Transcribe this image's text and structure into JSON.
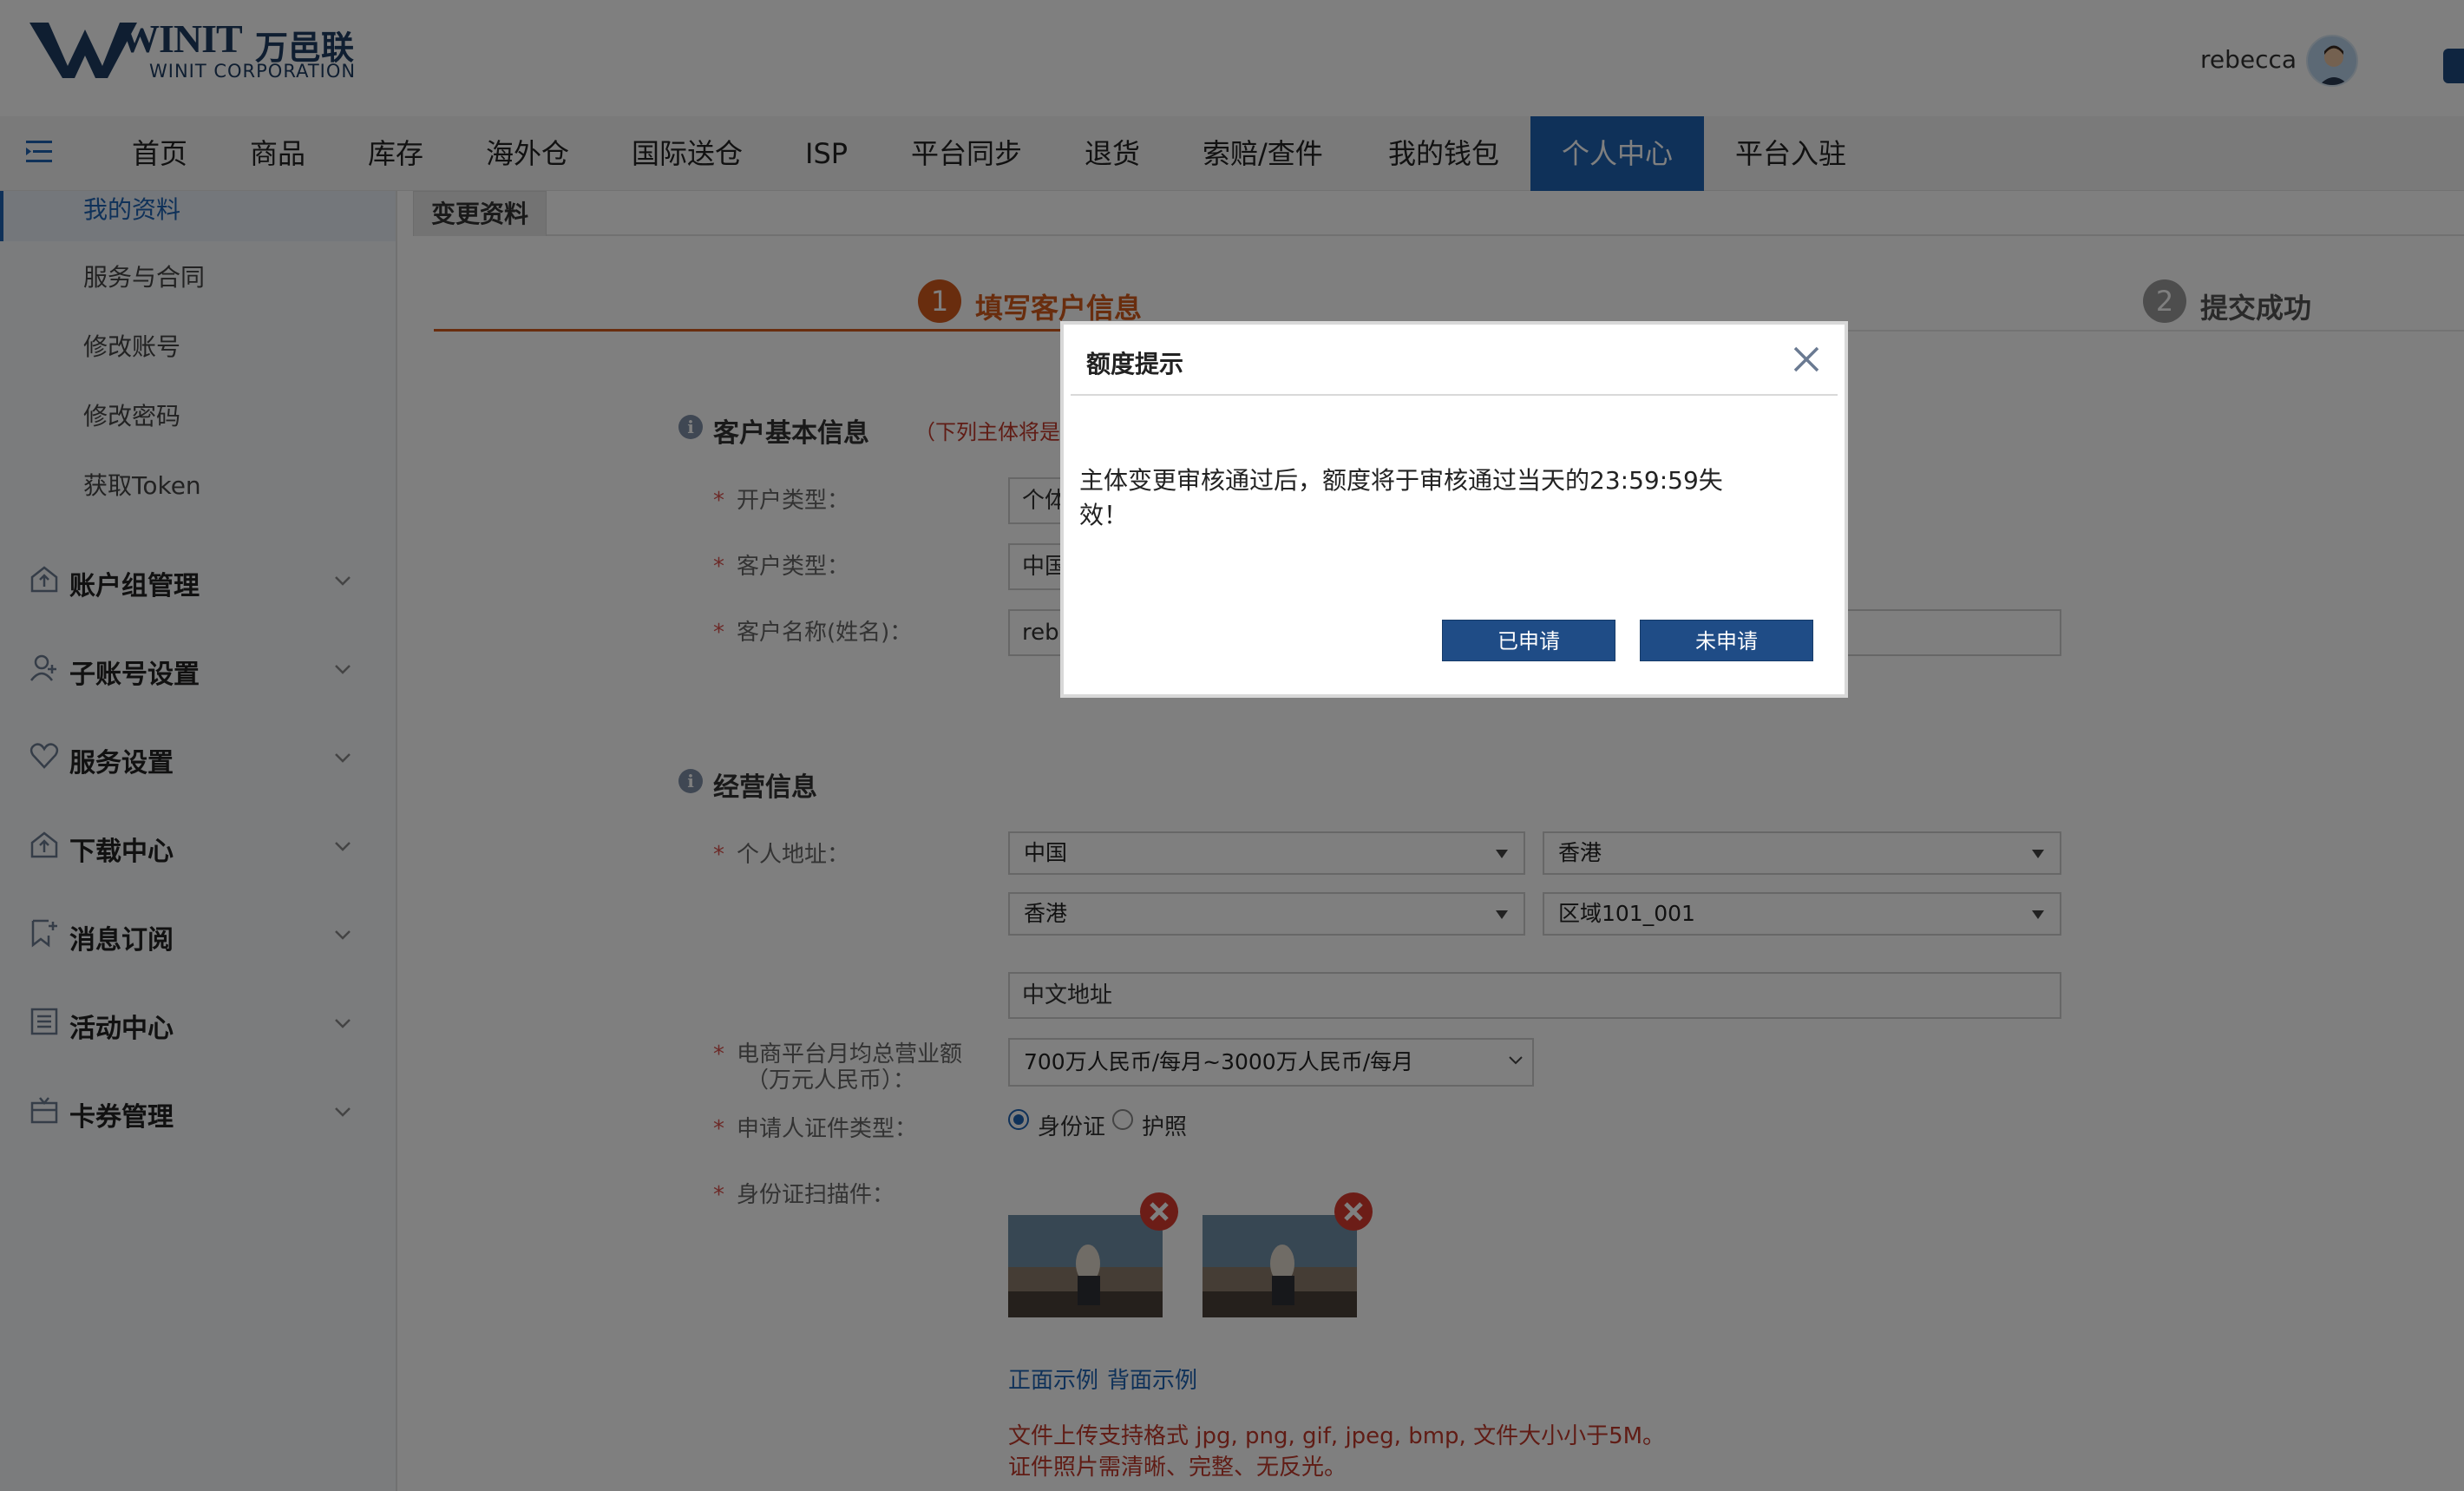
{
  "header": {
    "logo_text": "WINIT",
    "logo_cn": "万邑联",
    "logo_sub": "WINIT CORPORATION",
    "username": "rebecca"
  },
  "nav": {
    "items": [
      "首页",
      "商品",
      "库存",
      "海外仓",
      "国际送仓",
      "ISP",
      "平台同步",
      "退货",
      "索赔/查件",
      "我的钱包",
      "个人中心",
      "平台入驻"
    ],
    "active": "个人中心"
  },
  "sidebar": {
    "sub_items": [
      "我的资料",
      "服务与合同",
      "修改账号",
      "修改密码",
      "获取Token"
    ],
    "groups": [
      "账户组管理",
      "子账号设置",
      "服务设置",
      "下载中心",
      "消息订阅",
      "活动中心",
      "卡券管理"
    ]
  },
  "content": {
    "tab": "变更资料",
    "steps": [
      {
        "num": "1",
        "label": "填写客户信息"
      },
      {
        "num": "2",
        "label": "提交成功"
      }
    ],
    "basic": {
      "title": "客户基本信息",
      "note": "（下列主体将是你",
      "fields": [
        {
          "label": "开户类型：",
          "value": "个体"
        },
        {
          "label": "客户类型：",
          "value": "中国"
        },
        {
          "label": "客户名称(姓名)：",
          "value": "rebe"
        }
      ]
    },
    "business": {
      "title": "经营信息",
      "address_label": "个人地址：",
      "country": "中国",
      "province": "香港",
      "city": "香港",
      "district": "区域101_001",
      "address_cn": "中文地址",
      "revenue_label_1": "电商平台月均总营业额",
      "revenue_label_2": "（万元人民币）：",
      "revenue_value": "700万人民币/每月~3000万人民币/每月",
      "id_type_label": "申请人证件类型：",
      "id_option_1": "身份证",
      "id_option_2": "护照",
      "scan_label": "身份证扫描件：",
      "front_example": "正面示例",
      "back_example": "背面示例",
      "hint_1": "文件上传支持格式 jpg, png, gif, jpeg, bmp, 文件大小小于5M。",
      "hint_2": "证件照片需清晰、完整、无反光。"
    }
  },
  "modal": {
    "title": "额度提示",
    "body": "主体变更审核通过后，额度将于审核通过当天的23:59:59失效！",
    "btn_applied": "已申请",
    "btn_not_applied": "未申请"
  },
  "colors": {
    "primary": "#1f63b3",
    "step_active": "#d35a1c",
    "modal_button": "#1f4c86"
  }
}
